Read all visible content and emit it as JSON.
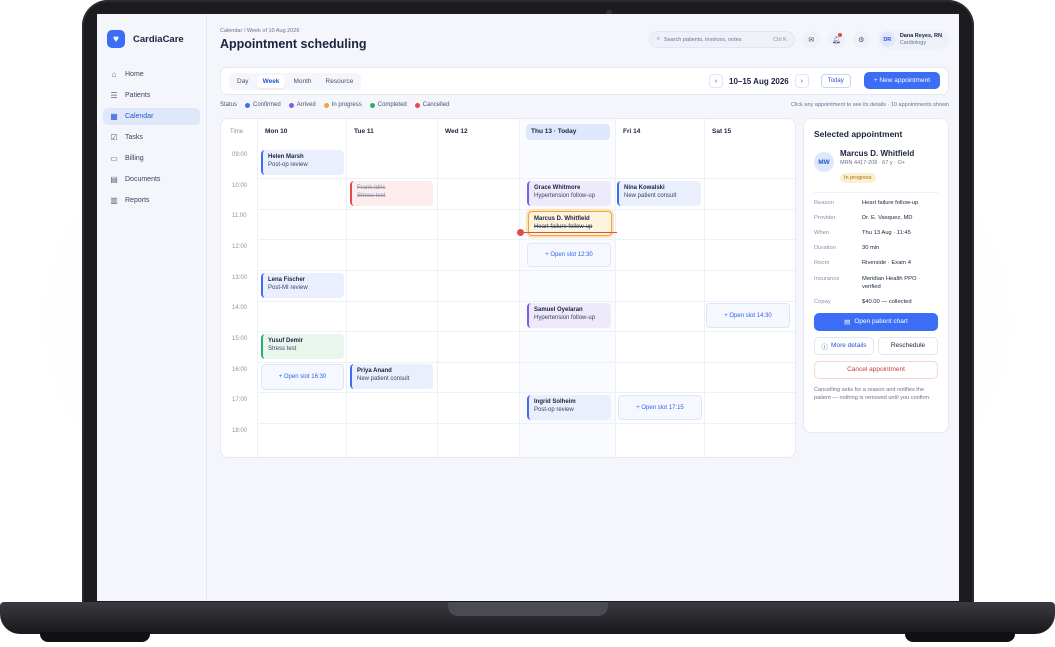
{
  "app": {
    "name": "CardiaCare"
  },
  "sidebar": {
    "items": [
      {
        "label": "Home",
        "icon": "home-icon"
      },
      {
        "label": "Patients",
        "icon": "patients-icon"
      },
      {
        "label": "Calendar",
        "icon": "calendar-icon",
        "active": true
      },
      {
        "label": "Tasks",
        "icon": "tasks-icon"
      },
      {
        "label": "Billing",
        "icon": "billing-icon"
      },
      {
        "label": "Documents",
        "icon": "documents-icon"
      },
      {
        "label": "Reports",
        "icon": "reports-icon"
      }
    ]
  },
  "header": {
    "breadcrumb": "Calendar / Week of 10 Aug 2026",
    "title": "Appointment scheduling",
    "search_placeholder": "Search patients, invoices, notes",
    "search_shortcut": "Ctrl K",
    "user": {
      "initials": "DR",
      "name": "Dana Reyes, RN",
      "role": "Cardiology"
    }
  },
  "toolbar": {
    "views": [
      "Day",
      "Week",
      "Month",
      "Resource"
    ],
    "active_view": "Week",
    "date_range": "10–15 Aug 2026",
    "prev": "‹",
    "next": "›",
    "today_label": "Today",
    "new_label": "+ New appointment"
  },
  "legend": {
    "label": "Status",
    "items": [
      {
        "label": "Confirmed",
        "color": "#3b6ef5"
      },
      {
        "label": "Arrived",
        "color": "#7c5ce6"
      },
      {
        "label": "In progress",
        "color": "#f2a33a"
      },
      {
        "label": "Completed",
        "color": "#29b06a"
      },
      {
        "label": "Cancelled",
        "color": "#e24b4b"
      }
    ],
    "hint": "Click any appointment to see its details · 10 appointments shown"
  },
  "calendar": {
    "time_header": "Time",
    "times": [
      "09:00",
      "10:00",
      "11:00",
      "12:00",
      "13:00",
      "14:00",
      "15:00",
      "16:00",
      "17:00",
      "18:00"
    ],
    "days": [
      "Mon 10",
      "Tue 11",
      "Wed 12",
      "Thu 13 · Today",
      "Fri 14",
      "Sat 15"
    ],
    "appointments": [
      {
        "name": "Helen Marsh",
        "reason": "Post-op review"
      },
      {
        "name": "Frank Idris",
        "reason": "Stress test"
      },
      {
        "name": "Grace Whitmore",
        "reason": "Hypertension follow-up"
      },
      {
        "name": "Nina Kowalski",
        "reason": "New patient consult"
      },
      {
        "name": "Marcus D. Whitfield",
        "reason": "Heart failure follow-up"
      },
      {
        "name": "Lena Fischer",
        "reason": "Post-MI review"
      },
      {
        "name": "Samuel Oyelaran",
        "reason": "Hypertension follow-up"
      },
      {
        "name": "Yusuf Demir",
        "reason": "Stress test"
      },
      {
        "name": "Priya Anand",
        "reason": "New patient consult"
      },
      {
        "name": "Ingrid Solheim",
        "reason": "Post-op review"
      }
    ],
    "open_slots": [
      "+ Open slot 12:30",
      "+ Open slot 14:30",
      "+ Open slot 16:30",
      "+ Open slot 17:15"
    ]
  },
  "panel": {
    "title": "Selected appointment",
    "initials": "MW",
    "name": "Marcus D. Whitfield",
    "meta": "MRN 4417-208 · 67 y · O+",
    "status": "In progress",
    "details": [
      {
        "k": "Reason",
        "v": "Heart failure follow-up"
      },
      {
        "k": "Provider",
        "v": "Dr. E. Vasquez, MD"
      },
      {
        "k": "When",
        "v": "Thu 13 Aug · 11:45"
      },
      {
        "k": "Duration",
        "v": "30 min"
      },
      {
        "k": "Room",
        "v": "Riverside · Exam 4"
      },
      {
        "k": "Insurance",
        "v": "Meridian Health PPO · verified"
      },
      {
        "k": "Copay",
        "v": "$40.00 — collected"
      }
    ],
    "open_chart": "Open patient chart",
    "more_details": "More details",
    "reschedule": "Reschedule",
    "cancel": "Cancel appointment",
    "note": "Cancelling asks for a reason and notifies the patient — nothing is removed until you confirm."
  }
}
